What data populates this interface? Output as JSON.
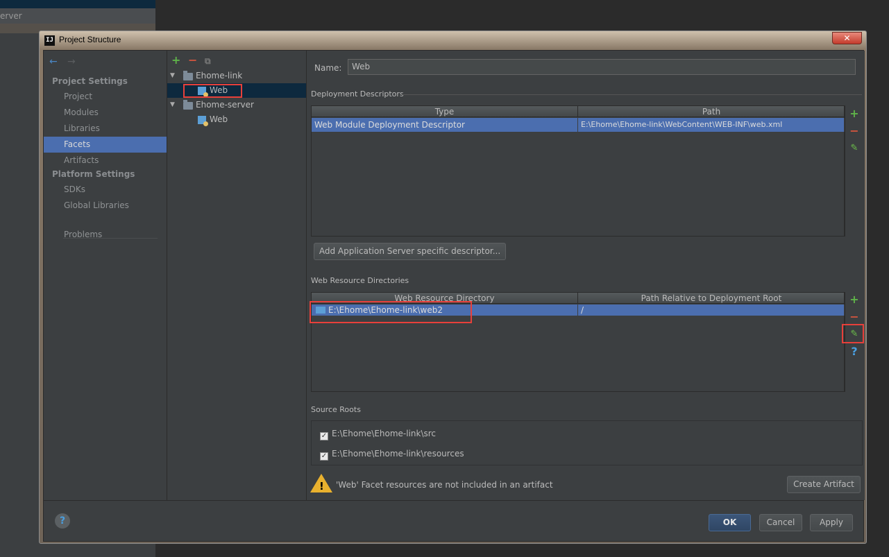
{
  "background": {
    "left_tab_text": "erver"
  },
  "dialog": {
    "title": "Project Structure",
    "app_icon_text": "IJ",
    "close_label": "✕"
  },
  "nav": {
    "back_icon": "←",
    "forward_icon": "→",
    "project_settings_header": "Project Settings",
    "project_items": [
      "Project",
      "Modules",
      "Libraries",
      "Facets",
      "Artifacts"
    ],
    "selected": "Facets",
    "platform_settings_header": "Platform Settings",
    "platform_items": [
      "SDKs",
      "Global Libraries"
    ],
    "problems": "Problems"
  },
  "tree": {
    "toolbar": {
      "add": "+",
      "remove": "−",
      "copy": "⧉"
    },
    "nodes": [
      {
        "label": "Ehome-link",
        "type": "module"
      },
      {
        "label": "Web",
        "type": "facet",
        "selected": true
      },
      {
        "label": "Ehome-server",
        "type": "module"
      },
      {
        "label": "Web",
        "type": "facet"
      }
    ]
  },
  "panel": {
    "name_label": "Name:",
    "name_value": "Web",
    "deployment": {
      "title": "Deployment Descriptors",
      "columns": [
        "Type",
        "Path"
      ],
      "rows": [
        {
          "type": "Web Module Deployment Descriptor",
          "path": "E:\\Ehome\\Ehome-link\\WebContent\\WEB-INF\\web.xml"
        }
      ],
      "add_server_button": "Add Application Server specific descriptor..."
    },
    "web_resources": {
      "title": "Web Resource Directories",
      "columns": [
        "Web Resource Directory",
        "Path Relative to Deployment Root"
      ],
      "rows": [
        {
          "directory": "E:\\Ehome\\Ehome-link\\web2",
          "relative": "/"
        }
      ]
    },
    "source_roots": {
      "title": "Source Roots",
      "items": [
        {
          "path": "E:\\Ehome\\Ehome-link\\src",
          "checked": true
        },
        {
          "path": "E:\\Ehome\\Ehome-link\\resources",
          "checked": true
        }
      ]
    },
    "warning": {
      "text": "'Web' Facet resources are not included in an artifact",
      "button": "Create Artifact"
    }
  },
  "tools": {
    "add": "+",
    "remove": "−",
    "edit": "✎",
    "help": "?"
  },
  "footer": {
    "help": "?",
    "ok": "OK",
    "cancel": "Cancel",
    "apply": "Apply"
  },
  "colors": {
    "selection": "#4b6eaf",
    "tree_selection": "#0d293e",
    "highlight_box": "#e8403a",
    "add_green": "#5fb349",
    "remove_red": "#d0553e",
    "warning_yellow": "#e9b12e"
  }
}
